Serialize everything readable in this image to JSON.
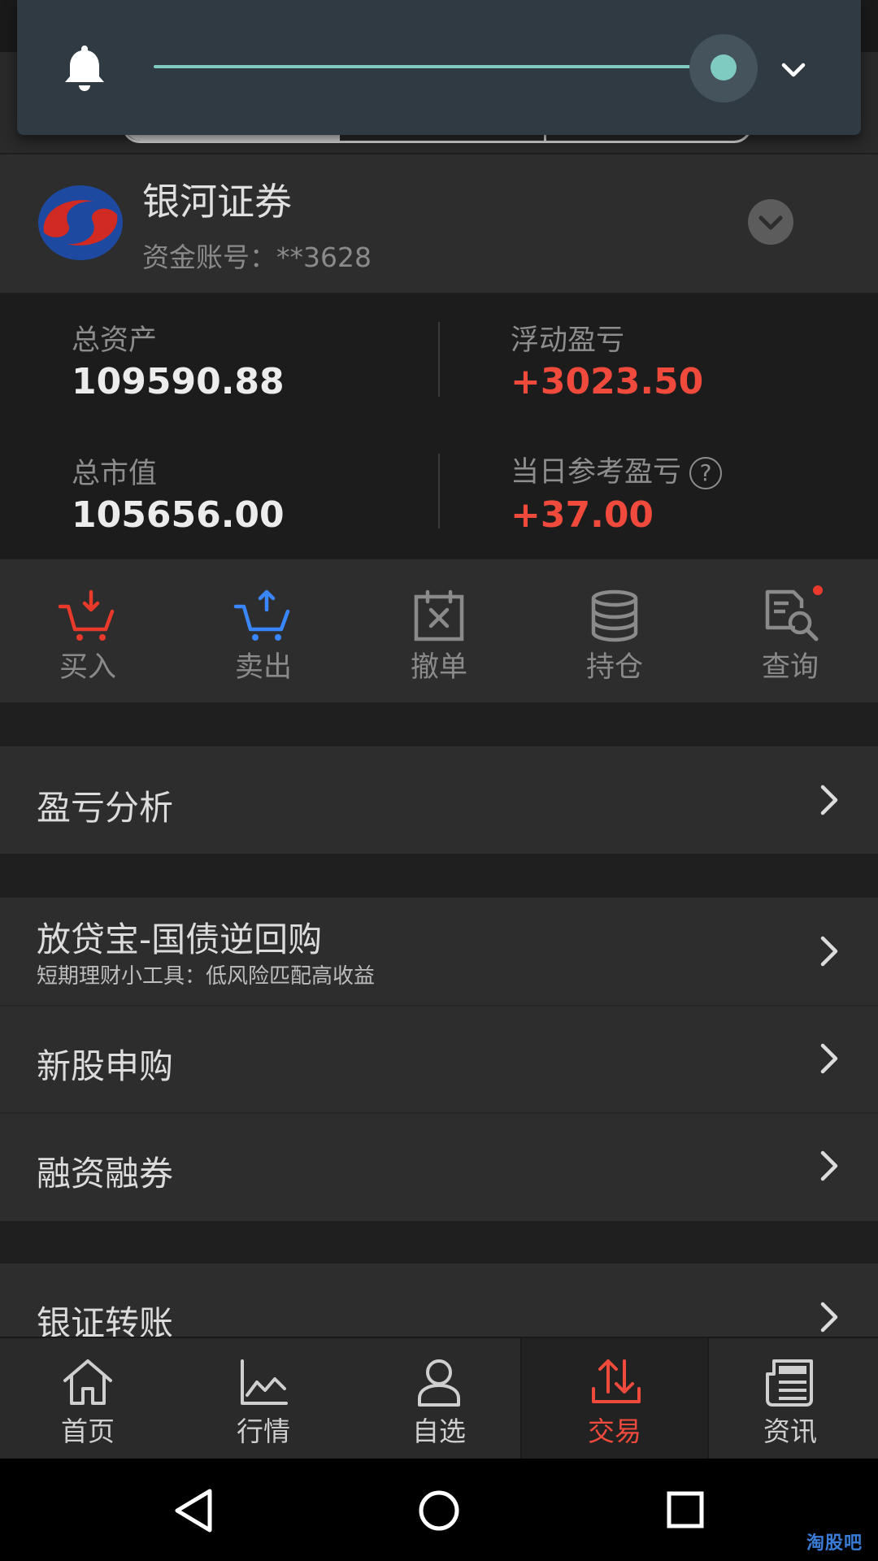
{
  "broker": {
    "name": "银河证券",
    "account": "资金账号：**3628"
  },
  "assets": {
    "total_assets_label": "总资产",
    "total_assets": "109590.88",
    "floating_pl_label": "浮动盈亏",
    "floating_pl": "+3023.50",
    "market_value_label": "总市值",
    "market_value": "105656.00",
    "daily_pl_label": "当日参考盈亏",
    "daily_pl": "+37.00",
    "help_glyph": "?"
  },
  "actions": [
    {
      "label": "买入",
      "icon": "cart-buy-icon",
      "color": "#e8392b"
    },
    {
      "label": "卖出",
      "icon": "cart-sell-icon",
      "color": "#3a86ff"
    },
    {
      "label": "撤单",
      "icon": "cancel-order-icon",
      "color": "#8a8a8a"
    },
    {
      "label": "持仓",
      "icon": "database-icon",
      "color": "#8a8a8a"
    },
    {
      "label": "查询",
      "icon": "search-document-icon",
      "color": "#8a8a8a"
    }
  ],
  "menu": {
    "pl_analysis": "盈亏分析",
    "reverse_repo": "放贷宝-国债逆回购",
    "reverse_repo_sub": "短期理财小工具：低风险匹配高收益",
    "ipo": "新股申购",
    "margin": "融资融券",
    "bank_transfer": "银证转账"
  },
  "bottom_nav": [
    {
      "label": "首页",
      "icon": "home-icon",
      "active": false
    },
    {
      "label": "行情",
      "icon": "chart-icon",
      "active": false
    },
    {
      "label": "自选",
      "icon": "user-icon",
      "active": false
    },
    {
      "label": "交易",
      "icon": "trade-icon",
      "active": true
    },
    {
      "label": "资讯",
      "icon": "news-icon",
      "active": false
    }
  ],
  "volume": {
    "level_fraction": 1.0
  },
  "watermark": "淘股吧",
  "colors": {
    "red": "#f04a3c",
    "accent": "#7fcbc2",
    "blue": "#3a86ff"
  }
}
